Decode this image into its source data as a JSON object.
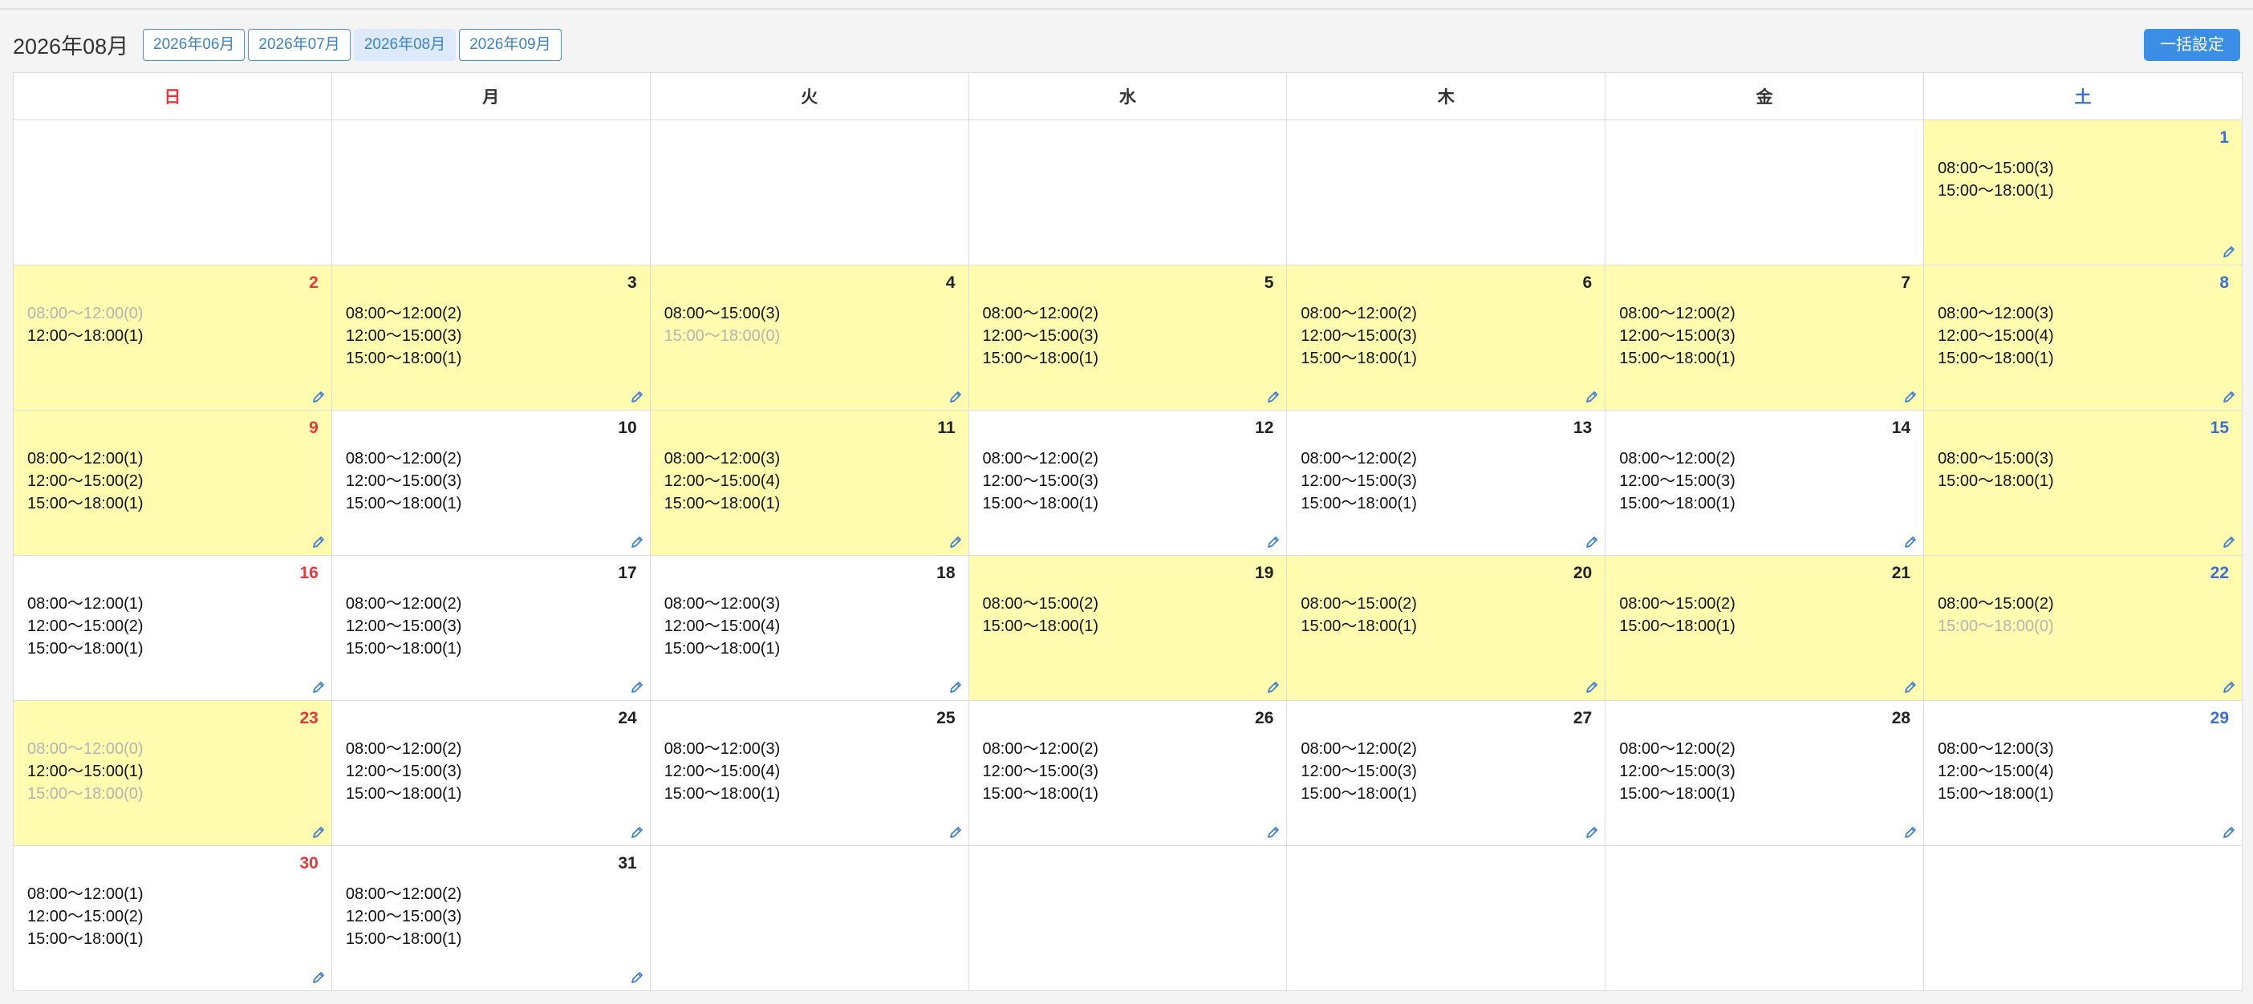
{
  "header": {
    "title": "2026年08月",
    "months": [
      {
        "label": "2026年06月",
        "active": false
      },
      {
        "label": "2026年07月",
        "active": false
      },
      {
        "label": "2026年08月",
        "active": true
      },
      {
        "label": "2026年09月",
        "active": false
      }
    ],
    "bulk_label": "一括設定"
  },
  "weekdays": [
    "日",
    "月",
    "火",
    "水",
    "木",
    "金",
    "土"
  ],
  "colors": {
    "highlight": "#fffcb0",
    "sunday": "#e8383d",
    "saturday": "#3b6fd4",
    "accent": "#3a8ee6"
  },
  "weeks": [
    [
      null,
      null,
      null,
      null,
      null,
      null,
      {
        "day": "1",
        "hl": true,
        "slots": [
          {
            "text": "08:00〜15:00(3)",
            "dim": false
          },
          {
            "text": "15:00〜18:00(1)",
            "dim": false
          }
        ]
      }
    ],
    [
      {
        "day": "2",
        "hl": true,
        "slots": [
          {
            "text": "08:00〜12:00(0)",
            "dim": true
          },
          {
            "text": "12:00〜18:00(1)",
            "dim": false
          }
        ]
      },
      {
        "day": "3",
        "hl": true,
        "slots": [
          {
            "text": "08:00〜12:00(2)",
            "dim": false
          },
          {
            "text": "12:00〜15:00(3)",
            "dim": false
          },
          {
            "text": "15:00〜18:00(1)",
            "dim": false
          }
        ]
      },
      {
        "day": "4",
        "hl": true,
        "slots": [
          {
            "text": "08:00〜15:00(3)",
            "dim": false
          },
          {
            "text": "15:00〜18:00(0)",
            "dim": true
          }
        ]
      },
      {
        "day": "5",
        "hl": true,
        "slots": [
          {
            "text": "08:00〜12:00(2)",
            "dim": false
          },
          {
            "text": "12:00〜15:00(3)",
            "dim": false
          },
          {
            "text": "15:00〜18:00(1)",
            "dim": false
          }
        ]
      },
      {
        "day": "6",
        "hl": true,
        "slots": [
          {
            "text": "08:00〜12:00(2)",
            "dim": false
          },
          {
            "text": "12:00〜15:00(3)",
            "dim": false
          },
          {
            "text": "15:00〜18:00(1)",
            "dim": false
          }
        ]
      },
      {
        "day": "7",
        "hl": true,
        "slots": [
          {
            "text": "08:00〜12:00(2)",
            "dim": false
          },
          {
            "text": "12:00〜15:00(3)",
            "dim": false
          },
          {
            "text": "15:00〜18:00(1)",
            "dim": false
          }
        ]
      },
      {
        "day": "8",
        "hl": true,
        "slots": [
          {
            "text": "08:00〜12:00(3)",
            "dim": false
          },
          {
            "text": "12:00〜15:00(4)",
            "dim": false
          },
          {
            "text": "15:00〜18:00(1)",
            "dim": false
          }
        ]
      }
    ],
    [
      {
        "day": "9",
        "hl": true,
        "slots": [
          {
            "text": "08:00〜12:00(1)",
            "dim": false
          },
          {
            "text": "12:00〜15:00(2)",
            "dim": false
          },
          {
            "text": "15:00〜18:00(1)",
            "dim": false
          }
        ]
      },
      {
        "day": "10",
        "hl": false,
        "slots": [
          {
            "text": "08:00〜12:00(2)",
            "dim": false
          },
          {
            "text": "12:00〜15:00(3)",
            "dim": false
          },
          {
            "text": "15:00〜18:00(1)",
            "dim": false
          }
        ]
      },
      {
        "day": "11",
        "hl": true,
        "slots": [
          {
            "text": "08:00〜12:00(3)",
            "dim": false
          },
          {
            "text": "12:00〜15:00(4)",
            "dim": false
          },
          {
            "text": "15:00〜18:00(1)",
            "dim": false
          }
        ]
      },
      {
        "day": "12",
        "hl": false,
        "slots": [
          {
            "text": "08:00〜12:00(2)",
            "dim": false
          },
          {
            "text": "12:00〜15:00(3)",
            "dim": false
          },
          {
            "text": "15:00〜18:00(1)",
            "dim": false
          }
        ]
      },
      {
        "day": "13",
        "hl": false,
        "slots": [
          {
            "text": "08:00〜12:00(2)",
            "dim": false
          },
          {
            "text": "12:00〜15:00(3)",
            "dim": false
          },
          {
            "text": "15:00〜18:00(1)",
            "dim": false
          }
        ]
      },
      {
        "day": "14",
        "hl": false,
        "slots": [
          {
            "text": "08:00〜12:00(2)",
            "dim": false
          },
          {
            "text": "12:00〜15:00(3)",
            "dim": false
          },
          {
            "text": "15:00〜18:00(1)",
            "dim": false
          }
        ]
      },
      {
        "day": "15",
        "hl": true,
        "slots": [
          {
            "text": "08:00〜15:00(3)",
            "dim": false
          },
          {
            "text": "15:00〜18:00(1)",
            "dim": false
          }
        ]
      }
    ],
    [
      {
        "day": "16",
        "hl": false,
        "slots": [
          {
            "text": "08:00〜12:00(1)",
            "dim": false
          },
          {
            "text": "12:00〜15:00(2)",
            "dim": false
          },
          {
            "text": "15:00〜18:00(1)",
            "dim": false
          }
        ]
      },
      {
        "day": "17",
        "hl": false,
        "slots": [
          {
            "text": "08:00〜12:00(2)",
            "dim": false
          },
          {
            "text": "12:00〜15:00(3)",
            "dim": false
          },
          {
            "text": "15:00〜18:00(1)",
            "dim": false
          }
        ]
      },
      {
        "day": "18",
        "hl": false,
        "slots": [
          {
            "text": "08:00〜12:00(3)",
            "dim": false
          },
          {
            "text": "12:00〜15:00(4)",
            "dim": false
          },
          {
            "text": "15:00〜18:00(1)",
            "dim": false
          }
        ]
      },
      {
        "day": "19",
        "hl": true,
        "slots": [
          {
            "text": "08:00〜15:00(2)",
            "dim": false
          },
          {
            "text": "15:00〜18:00(1)",
            "dim": false
          }
        ]
      },
      {
        "day": "20",
        "hl": true,
        "slots": [
          {
            "text": "08:00〜15:00(2)",
            "dim": false
          },
          {
            "text": "15:00〜18:00(1)",
            "dim": false
          }
        ]
      },
      {
        "day": "21",
        "hl": true,
        "slots": [
          {
            "text": "08:00〜15:00(2)",
            "dim": false
          },
          {
            "text": "15:00〜18:00(1)",
            "dim": false
          }
        ]
      },
      {
        "day": "22",
        "hl": true,
        "slots": [
          {
            "text": "08:00〜15:00(2)",
            "dim": false
          },
          {
            "text": "15:00〜18:00(0)",
            "dim": true
          }
        ]
      }
    ],
    [
      {
        "day": "23",
        "hl": true,
        "slots": [
          {
            "text": "08:00〜12:00(0)",
            "dim": true
          },
          {
            "text": "12:00〜15:00(1)",
            "dim": false
          },
          {
            "text": "15:00〜18:00(0)",
            "dim": true
          }
        ]
      },
      {
        "day": "24",
        "hl": false,
        "slots": [
          {
            "text": "08:00〜12:00(2)",
            "dim": false
          },
          {
            "text": "12:00〜15:00(3)",
            "dim": false
          },
          {
            "text": "15:00〜18:00(1)",
            "dim": false
          }
        ]
      },
      {
        "day": "25",
        "hl": false,
        "slots": [
          {
            "text": "08:00〜12:00(3)",
            "dim": false
          },
          {
            "text": "12:00〜15:00(4)",
            "dim": false
          },
          {
            "text": "15:00〜18:00(1)",
            "dim": false
          }
        ]
      },
      {
        "day": "26",
        "hl": false,
        "slots": [
          {
            "text": "08:00〜12:00(2)",
            "dim": false
          },
          {
            "text": "12:00〜15:00(3)",
            "dim": false
          },
          {
            "text": "15:00〜18:00(1)",
            "dim": false
          }
        ]
      },
      {
        "day": "27",
        "hl": false,
        "slots": [
          {
            "text": "08:00〜12:00(2)",
            "dim": false
          },
          {
            "text": "12:00〜15:00(3)",
            "dim": false
          },
          {
            "text": "15:00〜18:00(1)",
            "dim": false
          }
        ]
      },
      {
        "day": "28",
        "hl": false,
        "slots": [
          {
            "text": "08:00〜12:00(2)",
            "dim": false
          },
          {
            "text": "12:00〜15:00(3)",
            "dim": false
          },
          {
            "text": "15:00〜18:00(1)",
            "dim": false
          }
        ]
      },
      {
        "day": "29",
        "hl": false,
        "slots": [
          {
            "text": "08:00〜12:00(3)",
            "dim": false
          },
          {
            "text": "12:00〜15:00(4)",
            "dim": false
          },
          {
            "text": "15:00〜18:00(1)",
            "dim": false
          }
        ]
      }
    ],
    [
      {
        "day": "30",
        "hl": false,
        "slots": [
          {
            "text": "08:00〜12:00(1)",
            "dim": false
          },
          {
            "text": "12:00〜15:00(2)",
            "dim": false
          },
          {
            "text": "15:00〜18:00(1)",
            "dim": false
          }
        ]
      },
      {
        "day": "31",
        "hl": false,
        "slots": [
          {
            "text": "08:00〜12:00(2)",
            "dim": false
          },
          {
            "text": "12:00〜15:00(3)",
            "dim": false
          },
          {
            "text": "15:00〜18:00(1)",
            "dim": false
          }
        ]
      },
      null,
      null,
      null,
      null,
      null
    ]
  ]
}
